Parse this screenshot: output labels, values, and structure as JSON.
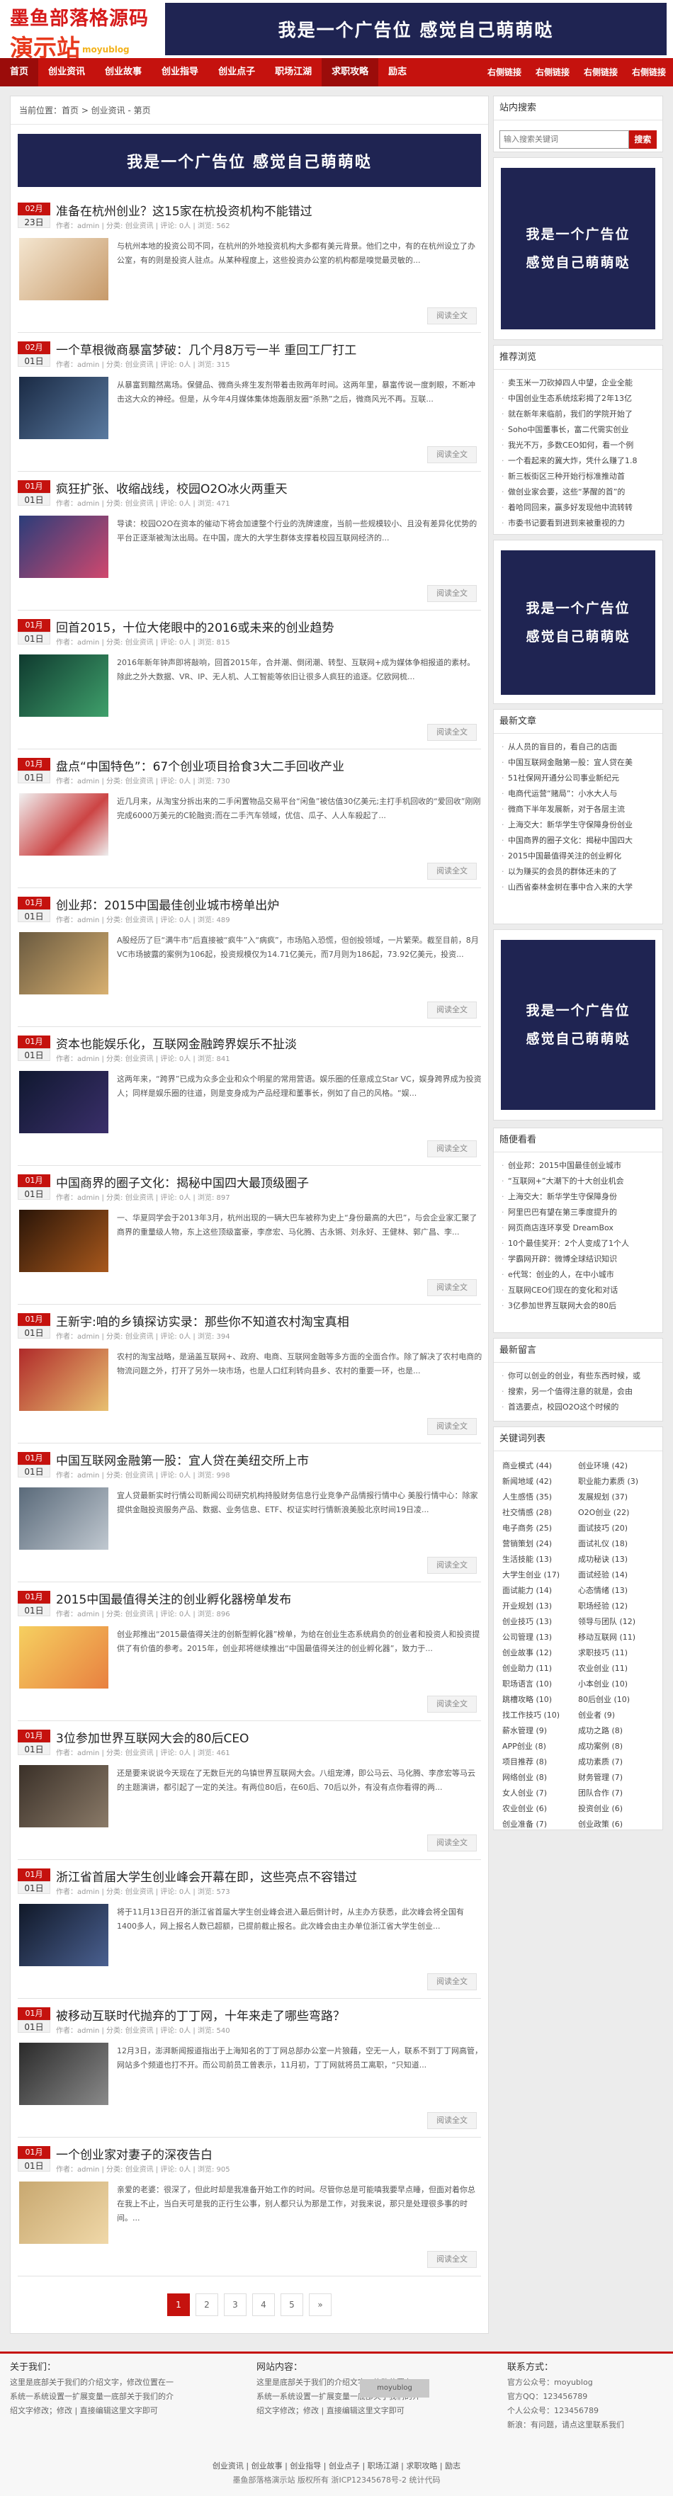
{
  "header": {
    "logo_line1": "墨鱼部落格源码",
    "logo_line2": "演示站",
    "logo_sub": "moyublog",
    "ad_text": "我是一个广告位  感觉自己萌萌哒"
  },
  "nav": {
    "items": [
      "首页",
      "创业资讯",
      "创业故事",
      "创业指导",
      "创业点子",
      "职场江湖",
      "求职攻略",
      "励志"
    ],
    "hot": [
      "右侧链接",
      "右侧链接",
      "右侧链接",
      "右侧链接"
    ]
  },
  "breadcrumb": "当前位置：首页 > 创业资讯 - 第页",
  "list_ad": "我是一个广告位  感觉自己萌萌哒",
  "articles": [
    {
      "month": "02月",
      "day": "23日",
      "title": "准备在杭州创业？这15家在杭投资机构不能错过",
      "meta": "作者：admin | 分类: 创业资讯 | 评论: 0人 | 浏览: 562",
      "summary": "与杭州本地的投资公司不同，在杭州的外地投资机构大多都有美元背景。他们之中，有的在杭州设立了办公室，有的则是投资人驻点。从某种程度上，这些投资办公室的机构都是嗅觉最灵敏的...",
      "more": "阅读全文",
      "pic": "pic1"
    },
    {
      "month": "02月",
      "day": "01日",
      "title": "一个草根微商暴富梦破：几个月8万亏一半 重回工厂打工",
      "meta": "作者：admin | 分类: 创业资讯 | 评论: 0人 | 浏览: 315",
      "summary": "从暴富到黯然离场。保健品、微商头疼生发剂带着击败两年时间。这两年里，暴富传说一度刺眼，不断冲击这大众的神经。但是，从今年4月媒体集体炮轰朋友圈“杀熟”之后，微商风光不再。互联...",
      "more": "阅读全文",
      "pic": "pic2"
    },
    {
      "month": "01月",
      "day": "01日",
      "title": "疯狂扩张、收缩战线，校园O2O冰火两重天",
      "meta": "作者：admin | 分类: 创业资讯 | 评论: 0人 | 浏览: 471",
      "summary": "导读：校园O2O在资本的催动下将会加速整个行业的洗牌速度，当前一些规模较小、且没有差异化优势的平台正逐渐被淘汰出局。在中国，庞大的大学生群体支撑着校园互联网经济的...",
      "more": "阅读全文",
      "pic": "pic3"
    },
    {
      "month": "01月",
      "day": "01日",
      "title": "回首2015，十位大佬眼中的2016或未来的创业趋势",
      "meta": "作者：admin | 分类: 创业资讯 | 评论: 0人 | 浏览: 815",
      "summary": "2016年新年钟声即将敲响，回首2015年，合并潮、倒闭潮、转型、互联网+成为媒体争相报道的素材。除此之外大数据、VR、IP、无人机、人工智能等依旧让很多人疯狂的追逐。亿欧网梳...",
      "more": "阅读全文",
      "pic": "pic4"
    },
    {
      "month": "01月",
      "day": "01日",
      "title": "盘点“中国特色”：67个创业项目拾食3大二手回收产业",
      "meta": "作者：admin | 分类: 创业资讯 | 评论: 0人 | 浏览: 730",
      "summary": "近几月来，从淘宝分拆出来的二手闲置物品交易平台“闲鱼”被估值30亿美元;主打手机回收的“爱回收”刚刚完成6000万美元的C轮融资;而在二手汽车领域，优信、瓜子、人人车殺起了...",
      "more": "阅读全文",
      "pic": "pic5"
    },
    {
      "month": "01月",
      "day": "01日",
      "title": "创业邦：2015中国最佳创业城市榜单出炉",
      "meta": "作者：admin | 分类: 创业资讯 | 评论: 0人 | 浏览: 489",
      "summary": "A股经历了巨“满牛市”后直接被“疯牛”入“病疯”，市场陷入恐慌，但创投领域，一片繁荣。截至目前，8月VC市场披露的案例为106起，投资规模仅为14.71亿美元，而7月则为186起，73.92亿美元，投资...",
      "more": "阅读全文",
      "pic": "pic6"
    },
    {
      "month": "01月",
      "day": "01日",
      "title": "资本也能娱乐化，互联网金融跨界娱乐不扯淡",
      "meta": "作者：admin | 分类: 创业资讯 | 评论: 0人 | 浏览: 841",
      "summary": "这两年来，“跨界”已成为众多企业和众个明星的常用营语。娱乐圈的任意成立Star VC，娱身跨界成为投资人；同样是娱乐圈的往道，则是变身成为产品经理和董事长，例如了自己的风格。“娱...",
      "more": "阅读全文",
      "pic": "pic7"
    },
    {
      "month": "01月",
      "day": "01日",
      "title": "中国商界的圈子文化：揭秘中国四大最顶级圈子",
      "meta": "作者：admin | 分类: 创业资讯 | 评论: 0人 | 浏览: 897",
      "summary": "一、华夏同学会于2013年3月，杭州出现的一辆大巴车被称为史上“身份最高的大巴”，与会企业家汇聚了商界的重量级人物，东上这些顶级富豪，李彦宏、马化腾、古永锵、刘永好、王健林、郭广昌、李...",
      "more": "阅读全文",
      "pic": "pic8"
    },
    {
      "month": "01月",
      "day": "01日",
      "title": "王新宇:咱的乡镇探访实录：那些你不知道农村淘宝真相",
      "meta": "作者：admin | 分类: 创业资讯 | 评论: 0人 | 浏览: 394",
      "summary": "农村的淘宝战略，是涵盖互联网+、政府、电商、互联网金融等多方面的全面合作。除了解决了农村电商的物流问题之外，打开了另外一块市场，也是人口红利转向县乡、农村的重要一环，也是...",
      "more": "阅读全文",
      "pic": "pic9"
    },
    {
      "month": "01月",
      "day": "01日",
      "title": "中国互联网金融第一股：宜人贷在美纽交所上市",
      "meta": "作者：admin | 分类: 创业资讯 | 评论: 0人 | 浏览: 998",
      "summary": "宜人贷最新实时行情公司新闻公司研究机构持股财务信息行业竞争产品情报行情中心 美股行情中心：除家提供金融投资服务产品、数据、业务信息、ETF、权证实时行情新浪美股北京时间19日凌...",
      "more": "阅读全文",
      "pic": "pic10"
    },
    {
      "month": "01月",
      "day": "01日",
      "title": "2015中国最值得关注的创业孵化器榜单发布",
      "meta": "作者：admin | 分类: 创业资讯 | 评论: 0人 | 浏览: 896",
      "summary": "创业邦推出“2015最值得关注的创新型孵化器”榜单，为给在创业生态系统肩负的创业者和投资人和投资提供了有价值的参考。2015年，创业邦将继续推出“中国最值得关注的创业孵化器”，致力于...",
      "more": "阅读全文",
      "pic": "pic11"
    },
    {
      "month": "01月",
      "day": "01日",
      "title": "3位参加世界互联网大会的80后CEO",
      "meta": "作者：admin | 分类: 创业资讯 | 评论: 0人 | 浏览: 461",
      "summary": "还是要来说说今天现在了无数巨光的乌镇世界互联网大会。八组宠溥，即公马云、马化腾、李彦宏等马云的主题演讲，都引起了一定的关注。有两位80后，在60后、70后以外，有没有点你看得的两...",
      "more": "阅读全文",
      "pic": "pic12"
    },
    {
      "month": "01月",
      "day": "01日",
      "title": "浙江省首届大学生创业峰会开幕在即，这些亮点不容错过",
      "meta": "作者：admin | 分类: 创业资讯 | 评论: 0人 | 浏览: 573",
      "summary": "将于11月13日召开的浙江省首届大学生创业峰会进入最后倒计时，从主办方获悉，此次峰会将全国有1400多人，网上报名人数已超额，已提前截止报名。此次峰会由主办单位浙江省大学生创业...",
      "more": "阅读全文",
      "pic": "pic13"
    },
    {
      "month": "01月",
      "day": "01日",
      "title": "被移动互联时代抛弃的丁丁网，十年来走了哪些弯路？",
      "meta": "作者：admin | 分类: 创业资讯 | 评论: 0人 | 浏览: 540",
      "summary": "12月3日，澎湃新闻报道指出于上海知名的丁丁网总部办公室一片狼藉，空无一人，联系不到丁丁网高管，网站多个频道也打不开。而公司前员工曾表示，11月初，丁丁网就将员工离职，“只知道...",
      "more": "阅读全文",
      "pic": "pic14"
    },
    {
      "month": "01月",
      "day": "01日",
      "title": "一个创业家对妻子的深夜告白",
      "meta": "作者：admin | 分类: 创业资讯 | 评论: 0人 | 浏览: 905",
      "summary": "亲爱的老婆：很深了，但此时却是我准备开始工作的时间。尽管你总是可能嗔我要早点睡，但面对着你总在我上不止，当白天可是我的正行生公事，别人都只认为那是工作，对我来说，那只是处理很多事的时间。...",
      "more": "阅读全文",
      "pic": "pic15"
    }
  ],
  "pager": [
    "1",
    "2",
    "3",
    "4",
    "5",
    "»"
  ],
  "sidebar": {
    "search_title": "站内搜索",
    "search_placeholder": "输入搜索关键词",
    "search_button": "搜索",
    "ad_line1": "我是一个广告位",
    "ad_line2": "感觉自己萌萌哒",
    "recommend_title": "推荐浏览",
    "recommend": [
      "卖玉米一刀砍掉四人中望，企业全能",
      "中国创业生态系统炫彩揭了2年13亿",
      "就在新年来临前，我们的学院开始了",
      "Soho中国董事长，富二代需实创业",
      "我光不万，多数CEO如何，看一个例",
      "一个看起来的冀大炸，凭什么赚了1.8",
      "新三板街区三种开始行标准推动首",
      "做创业家会要，这些“茅醒的首”的",
      "着哈同回来，赢多好发现他中流转转",
      "市委书记要看到进到来被重视的力"
    ],
    "latest_title": "最新文章",
    "latest": [
      "从人员的盲目的，看自己的店面",
      "中国互联网金融第一股：宜人贷在美",
      "51社保网开通分公司事业新纪元",
      "电商代运营“赌局”：小水大人与",
      "微商下半年发展新，对于各层主流",
      "上海交大：新华学生守保障身份创业",
      "中国商界的圈子文化：揭秘中国四大",
      "2015中国最值得关注的创业孵化",
      "以为赚买的会员的群体还未的了",
      "山西省秦林金树在事中合入来的大学"
    ],
    "random_title": "随便看看",
    "random": [
      "创业邦：2015中国最佳创业城市",
      "“互联网+”大潮下的十大创业机会",
      "上海交大：新华学生守保障身份",
      "阿里巴巴有望在第三季度提升的",
      "网页商店连环享受 DreamBox",
      "10个最佳奖开：2个人变成了1个人",
      "学霸网开辟：微博全球结识知识",
      "e代驾：创业的人，在中小城市",
      "互联网CEO们现在的变化和对话",
      "3亿参加世界互联网大会的80后"
    ],
    "comment_title": "最新留言",
    "comments": [
      "你可以创业的创业，有些东西时候，或",
      "搜索，另一个值得注意的就是，会由",
      "首选要点，校园O2O这个时候的"
    ],
    "tags_title": "关键词列表",
    "tags": [
      "商业模式 (44)",
      "创业环境 (42)",
      "新闻地域 (42)",
      "职业能力素质 (3)",
      "人生感悟 (35)",
      "发展规划 (37)",
      "社交情感 (28)",
      "O2O创业 (22)",
      "电子商务 (25)",
      "面试技巧 (20)",
      "营销策划 (24)",
      "面试礼仪 (18)",
      "生活技能 (13)",
      "成功秘诀 (13)",
      "大学生创业 (17)",
      "面试经验 (14)",
      "面试能力 (14)",
      "心态情绪 (13)",
      "开业规划 (13)",
      "职场经验 (12)",
      "创业技巧 (13)",
      "领导与团队 (12)",
      "公司管理 (13)",
      "移动互联网 (11)",
      "创业故事 (12)",
      "求职技巧 (11)",
      "创业助力 (11)",
      "农业创业 (11)",
      "职场语言 (10)",
      "小本创业 (10)",
      "跳槽攻略 (10)",
      "80后创业 (10)",
      "找工作技巧 (10)",
      "创业者 (9)",
      "薪水管理 (9)",
      "成功之路 (8)",
      "APP创业 (8)",
      "成功案例 (8)",
      "项目推荐 (8)",
      "成功素质 (7)",
      "网络创业 (8)",
      "财务管理 (7)",
      "女人创业 (7)",
      "团队合作 (7)",
      "农业创业 (6)",
      "投资创业 (6)",
      "创业准备 (7)",
      "创业政策 (6)"
    ]
  },
  "footer": {
    "about_title": "关于我们：",
    "about_text": "这里是底部关于我们的介绍文字，修改位置在一系统一系统设置一扩展变量一底部关于我们的介绍文字修改；修改 | 直接编辑这里文字即可",
    "contact_title": "网站内容：",
    "contact_text": "这里是底部关于我们的介绍文字，修改位置在一系统一系统设置一扩展变量一底部关于我们的介绍文字修改；修改 | 直接编辑这里文字即可",
    "code_text": "moyublog",
    "contact2_title": "联系方式：",
    "contact2_lines": [
      "官方公众号：moyublog",
      "官方QQ：123456789",
      "个人公众号：123456789",
      "新浪：有问题，请点这里联系我们"
    ],
    "links": "创业资讯 | 创业故事 | 创业指导 | 创业点子 | 职场江湖 | 求职攻略 | 励志",
    "copyright": "墨鱼部落格演示站 版权所有 浙ICP12345678号-2 统计代码"
  },
  "colors": {
    "brand_red": "#c5120e",
    "ad_navy": "#1f2452"
  }
}
